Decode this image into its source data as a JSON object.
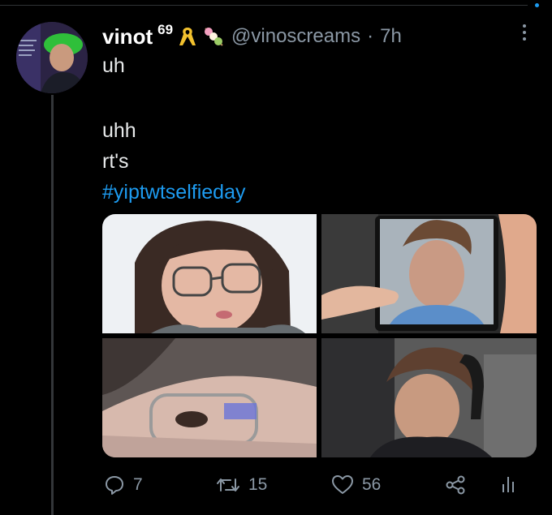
{
  "tweet": {
    "author_name": "vinot",
    "author_superscript": "69",
    "author_emojis": [
      "yellow-ribbon-emoji",
      "dango-emoji"
    ],
    "handle": "@vinoscreams",
    "separator": "·",
    "time": "7h",
    "lines": [
      "uh",
      "",
      "uhh",
      "rt's"
    ],
    "hashtag": "#yiptwtselfieday",
    "media_count": 4
  },
  "actions": {
    "reply_count": "7",
    "retweet_count": "15",
    "like_count": "56"
  },
  "icons": {
    "more": "more-vertical-icon",
    "reply": "reply-icon",
    "retweet": "retweet-icon",
    "like": "heart-icon",
    "share": "share-icon",
    "analytics": "analytics-icon"
  },
  "colors": {
    "background": "#000000",
    "text": "#e7e9ea",
    "secondary": "#8b98a5",
    "link": "#1d9bf0"
  }
}
